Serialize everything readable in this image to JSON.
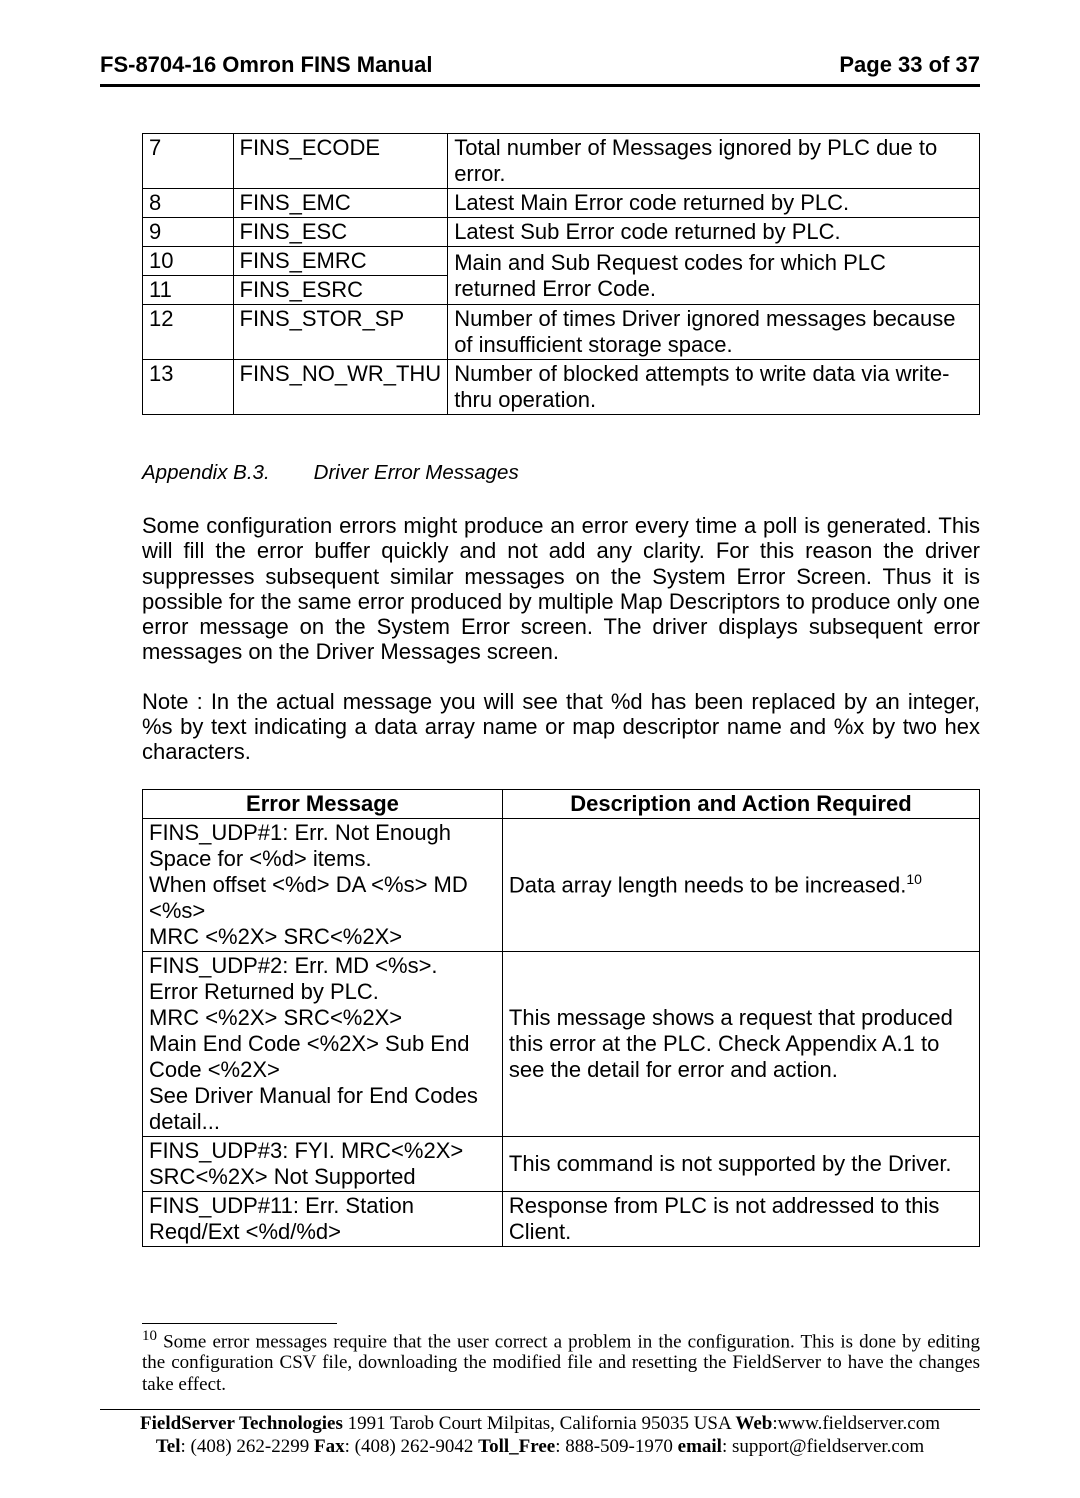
{
  "header": {
    "left": "FS-8704-16 Omron FINS Manual",
    "right": "Page 33 of 37"
  },
  "table1": {
    "rows": [
      {
        "c0": "7",
        "c1": "FINS_ECODE",
        "c2": "Total number of Messages ignored by PLC due to error."
      },
      {
        "c0": "8",
        "c1": "FINS_EMC",
        "c2": "Latest Main Error code returned by PLC."
      },
      {
        "c0": "9",
        "c1": "FINS_ESC",
        "c2": "Latest Sub Error code returned by PLC."
      },
      {
        "c0": "10",
        "c1": "FINS_EMRC",
        "c2": "Main and Sub Request codes for which PLC returned Error Code."
      },
      {
        "c0": "11",
        "c1": "FINS_ESRC",
        "c2": ""
      },
      {
        "c0": "12",
        "c1": "FINS_STOR_SP",
        "c2": "Number of times Driver ignored messages because of insufficient storage space."
      },
      {
        "c0": "13",
        "c1": "FINS_NO_WR_THU",
        "c2": "Number of blocked attempts to write data via write-thru operation."
      }
    ]
  },
  "section": {
    "label": "Appendix B.3.",
    "title": "Driver Error Messages"
  },
  "para1": "Some configuration errors might produce an error every time a poll is generated. This will fill the error buffer quickly and not add any clarity. For this reason the driver suppresses subsequent similar messages on the System Error Screen. Thus it is possible for the same error produced by multiple Map Descriptors to produce only one error message on the System Error screen.  The driver displays subsequent error messages on the Driver Messages screen.",
  "para2": "Note : In the actual message you will see that %d has been replaced by an integer, %s by text indicating a data array name or map descriptor name and %x by two hex characters.",
  "table2": {
    "headers": {
      "a": "Error Message",
      "b": "Description and Action Required"
    },
    "rows": [
      {
        "msg": "FINS_UDP#1: Err. Not Enough Space for <%d> items.\nWhen offset <%d> DA <%s> MD <%s>\nMRC <%2X> SRC<%2X>",
        "desc": "Data array length needs to be increased.",
        "fnref": "10"
      },
      {
        "msg": "FINS_UDP#2: Err. MD <%s>.\nError Returned by PLC.\nMRC <%2X> SRC<%2X>\nMain End Code <%2X> Sub End Code <%2X>\nSee Driver Manual for End Codes detail...",
        "desc": "This message shows a request that produced this error at the PLC. Check Appendix A.1 to see the detail for error and action."
      },
      {
        "msg": "FINS_UDP#3: FYI. MRC<%2X> SRC<%2X> Not Supported",
        "desc": "This command is not supported by the Driver."
      },
      {
        "msg": "FINS_UDP#11: Err. Station Reqd/Ext <%d/%d>",
        "desc": "Response from PLC is not addressed to this Client."
      }
    ]
  },
  "footnote": {
    "num": "10",
    "text": " Some error messages require that the user correct a problem in the configuration. This is done by editing the configuration CSV file, downloading the modified file and resetting the FieldServer to have the changes take effect."
  },
  "footer": {
    "line1_a": "FieldServer Technologies",
    "line1_b": " 1991 Tarob Court Milpitas, California 95035 USA  ",
    "line1_c": "Web",
    "line1_d": ":www.fieldserver.com",
    "line2_a": "Tel",
    "line2_b": ": (408) 262-2299  ",
    "line2_c": "Fax",
    "line2_d": ": (408) 262-9042  ",
    "line2_e": "Toll_Free",
    "line2_f": ": 888-509-1970  ",
    "line2_g": "email",
    "line2_h": ": support@fieldserver.com"
  }
}
